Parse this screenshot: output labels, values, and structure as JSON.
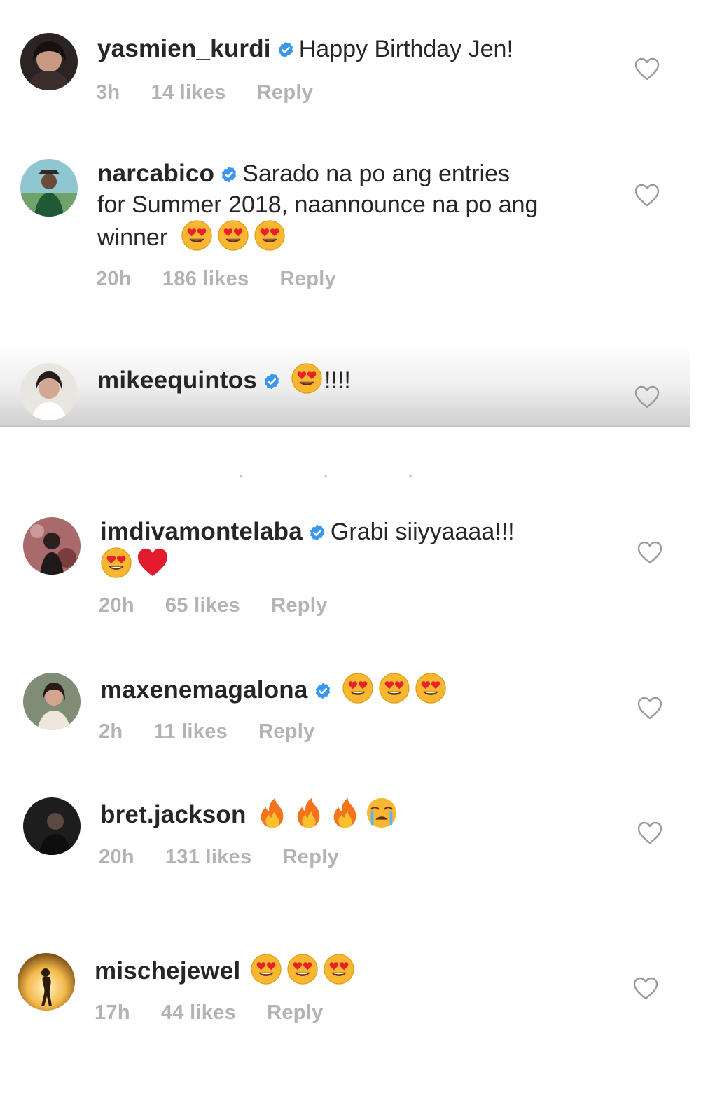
{
  "colors": {
    "verified": "#3897f0",
    "meta": "#b3b3b3",
    "text": "#262626"
  },
  "comments": [
    {
      "username": "yasmien_kurdi",
      "text_lines": [
        "Happy Birthday Jen!"
      ],
      "time": "3h",
      "likes": "14 likes",
      "reply": "Reply"
    },
    {
      "username": "narcabico",
      "text_lines": [
        "Sarado na po ang entries",
        "for Summer 2018, naannounce na po ang",
        "winner"
      ],
      "time": "20h",
      "likes": "186 likes",
      "reply": "Reply"
    },
    {
      "username": "mikeequintos",
      "text": "!!!!"
    },
    {
      "username": "imdivamontelaba",
      "text_lines": [
        "Grabi siiyyaaaa!!!"
      ],
      "time": "20h",
      "likes": "65 likes",
      "reply": "Reply"
    },
    {
      "username": "maxenemagalona",
      "time": "2h",
      "likes": "11 likes",
      "reply": "Reply"
    },
    {
      "username": "bret.jackson",
      "time": "20h",
      "likes": "131 likes",
      "reply": "Reply"
    },
    {
      "username": "mischejewel",
      "time": "17h",
      "likes": "44 likes",
      "reply": "Reply"
    }
  ],
  "icons": {
    "verified": "verified-badge-icon",
    "like": "heart-outline-icon",
    "emoji_heart_eyes": "heart-eyes-emoji",
    "emoji_red_heart": "red-heart-emoji",
    "emoji_fire": "fire-emoji",
    "emoji_crying": "loudly-crying-emoji"
  }
}
